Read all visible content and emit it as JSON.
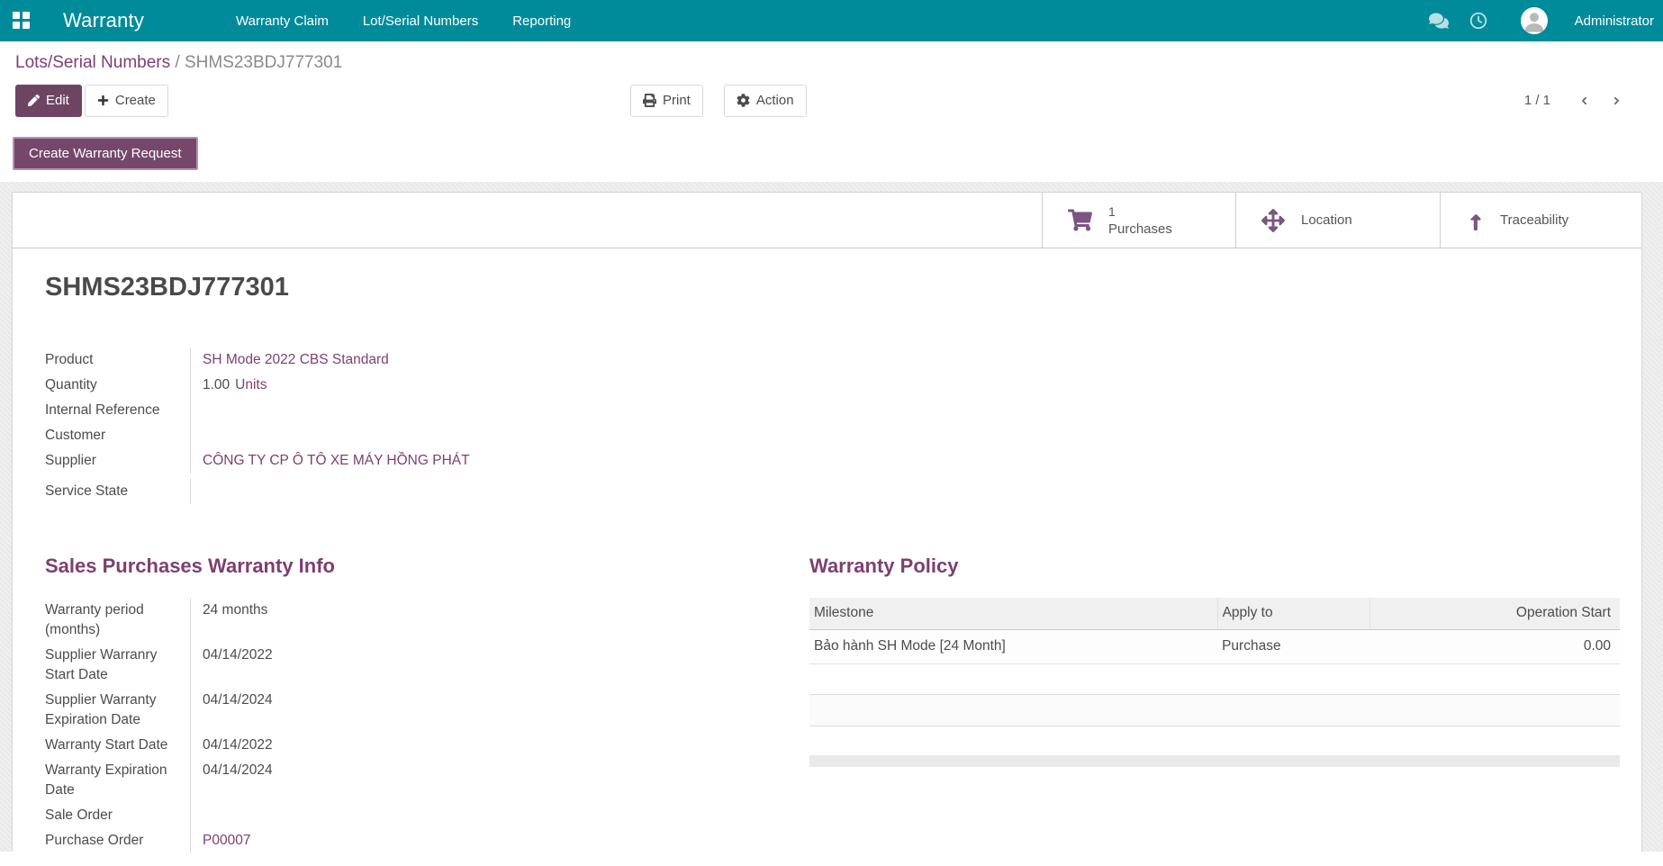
{
  "colors": {
    "navbar_teal": "#008b9b",
    "primary_purple": "#6d4563",
    "link_purple": "#7d3f70",
    "text_gray": "#4c4c4c"
  },
  "navbar": {
    "brand": "Warranty",
    "menu_items": [
      {
        "label": "Warranty Claim"
      },
      {
        "label": "Lot/Serial Numbers"
      },
      {
        "label": "Reporting"
      }
    ],
    "icons": [
      "apps-grid-icon",
      "messages-icon",
      "activities-clock-icon",
      "avatar"
    ],
    "user": "Administrator"
  },
  "breadcrumb": {
    "parent": "Lots/Serial Numbers",
    "separator": "/",
    "current": "SHMS23BDJ777301"
  },
  "control_panel": {
    "edit_label": "Edit",
    "create_label": "Create",
    "print_label": "Print",
    "action_label": "Action",
    "pager": "1 / 1"
  },
  "statusbar": {
    "create_warranty_request_label": "Create Warranty Request"
  },
  "smart_buttons": [
    {
      "icon": "shopping-cart-icon",
      "value": "1",
      "label": "Purchases"
    },
    {
      "icon": "arrows-move-icon",
      "label": "Location"
    },
    {
      "icon": "arrow-up-icon",
      "label": "Traceability"
    }
  ],
  "record": {
    "title": "SHMS23BDJ777301",
    "fields": [
      {
        "label": "Product",
        "value": "SH Mode 2022 CBS Standard"
      },
      {
        "label": "Quantity",
        "value": "1.00",
        "suffix": "Units"
      },
      {
        "label": "Internal Reference",
        "value": ""
      },
      {
        "label": "Customer",
        "value": ""
      },
      {
        "label": "Supplier",
        "value": "CÔNG TY CP Ô TÔ XE MÁY HỒNG PHÁT"
      },
      {
        "label": "Service State",
        "value": ""
      }
    ]
  },
  "warranty_info": {
    "title": "Sales Purchases Warranty Info",
    "fields": [
      {
        "label": "Warranty period (months)",
        "value": "24 months"
      },
      {
        "label": "Supplier Warranry Start Date",
        "value": "04/14/2022"
      },
      {
        "label": "Supplier Warranty Expiration Date",
        "value": "04/14/2024"
      },
      {
        "label": "Warranty Start Date",
        "value": "04/14/2022"
      },
      {
        "label": "Warranty Expiration Date",
        "value": "04/14/2024"
      },
      {
        "label": "Sale Order",
        "value": ""
      },
      {
        "label": "Purchase Order",
        "value": "P00007"
      }
    ]
  },
  "warranty_policy": {
    "title": "Warranty Policy",
    "table": {
      "headers": [
        "Milestone",
        "Apply to",
        "Operation Start"
      ],
      "rows": [
        {
          "milestone": "Bảo hành SH Mode [24 Month]",
          "apply_to": "Purchase",
          "operation_start": "0.00"
        }
      ]
    }
  }
}
